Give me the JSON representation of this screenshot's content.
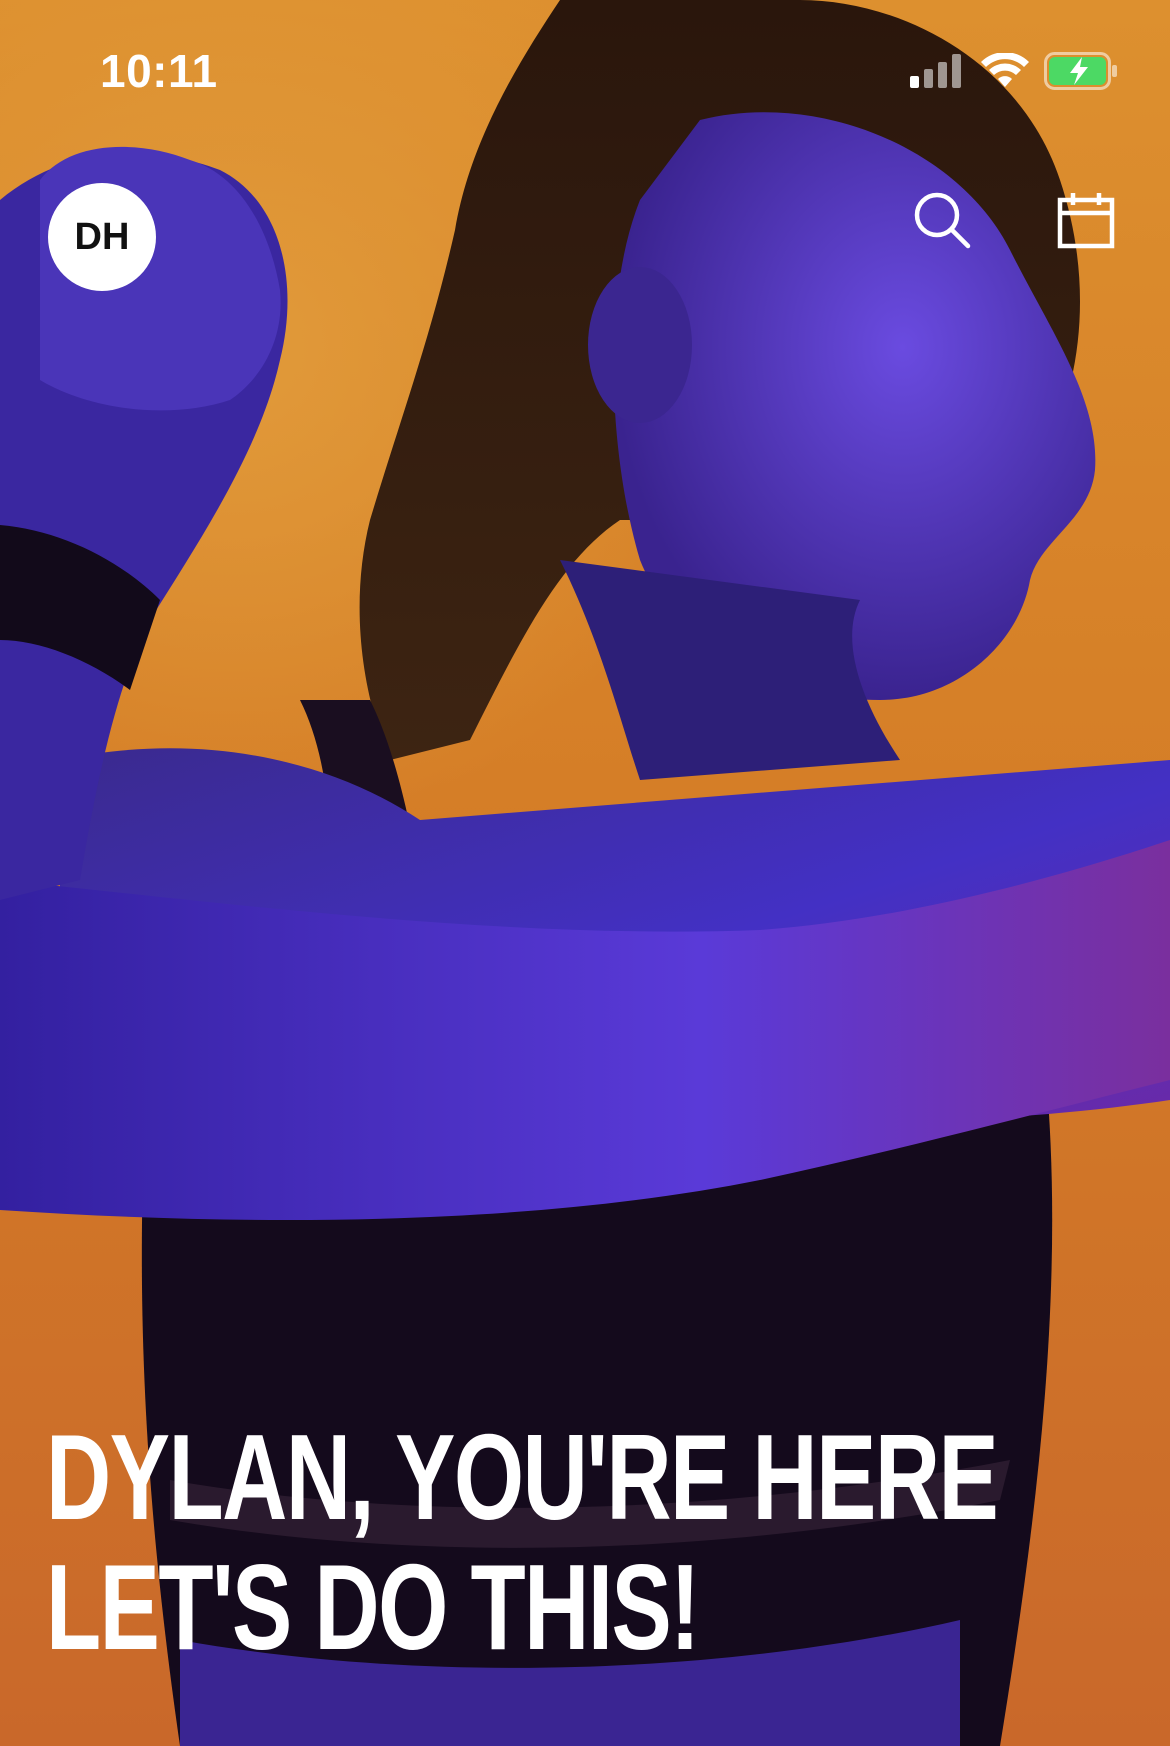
{
  "status_bar": {
    "time": "10:11",
    "signal_icon": "cellular-signal-icon",
    "wifi_icon": "wifi-icon",
    "battery_icon": "battery-charging-icon",
    "battery_color": "#4cd964"
  },
  "header": {
    "avatar_initials": "DH",
    "search_icon": "search-icon",
    "calendar_icon": "calendar-icon"
  },
  "hero": {
    "greeting_line1": "DYLAN, YOU'RE HERE",
    "greeting_line2": "LET'S DO THIS!",
    "background_color": "#d9822b",
    "accent_color": "#4b2fd6"
  }
}
